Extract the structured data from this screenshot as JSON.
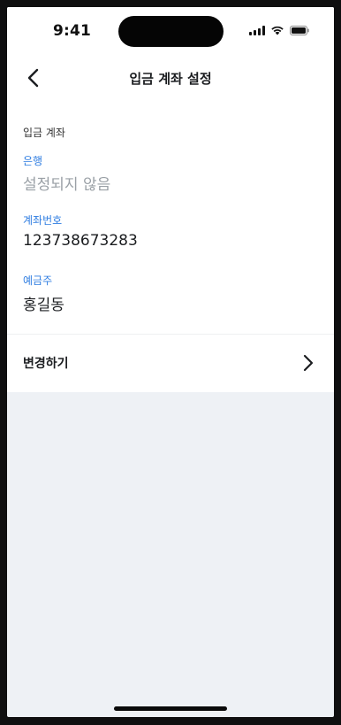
{
  "status_bar": {
    "time": "9:41"
  },
  "header": {
    "title": "입금 계좌 설정",
    "back_icon": "chevron-left-icon"
  },
  "account": {
    "section_label": "입금 계좌",
    "bank": {
      "label": "은행",
      "value": "설정되지 않음"
    },
    "account_number": {
      "label": "계좌번호",
      "value": "123738673283"
    },
    "holder": {
      "label": "예금주",
      "value": "홍길동"
    }
  },
  "change": {
    "label": "변경하기",
    "icon": "chevron-right-icon"
  },
  "colors": {
    "accent": "#2f7de1",
    "placeholder": "#9aa0a6",
    "background": "#eef1f5"
  }
}
